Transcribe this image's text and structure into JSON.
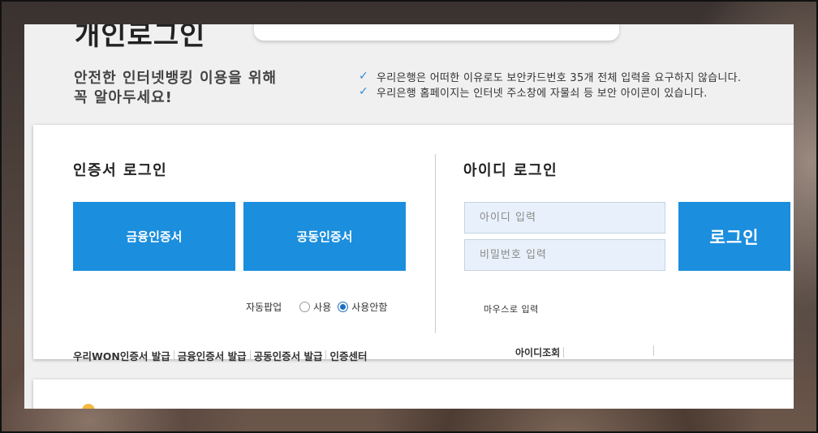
{
  "page": {
    "title": "개인로그인"
  },
  "notice": {
    "heading_line1": "안전한 인터넷뱅킹 이용을 위해",
    "heading_line2": "꼭 알아두세요!",
    "items": [
      "우리은행은 어떠한 이유로도 보안카드번호 35개 전체 입력을 요구하지 않습니다.",
      "우리은행 홈페이지는 인터넷 주소창에 자물쇠 등 보안 아이콘이 있습니다."
    ],
    "check_icon": "✓"
  },
  "cert_login": {
    "title": "인증서 로그인",
    "financial_cert_button": "금융인증서",
    "public_cert_button": "공동인증서",
    "auto_popup": {
      "label": "자동팝업",
      "options": [
        "사용",
        "사용안함"
      ],
      "selected": "사용안함"
    },
    "links": [
      "우리WON인증서 발급",
      "금융인증서 발급",
      "공동인증서 발급",
      "인증센터"
    ]
  },
  "id_login": {
    "title": "아이디 로그인",
    "id_placeholder": "아이디 입력",
    "password_placeholder": "비밀번호 입력",
    "login_button": "로그인",
    "mouse_input": "마우스로 입력",
    "find_id": "아이디조회"
  },
  "colors": {
    "primary_button": "#1b8ede",
    "input_bg": "#e8f1fb",
    "check": "#2a8ad8"
  }
}
